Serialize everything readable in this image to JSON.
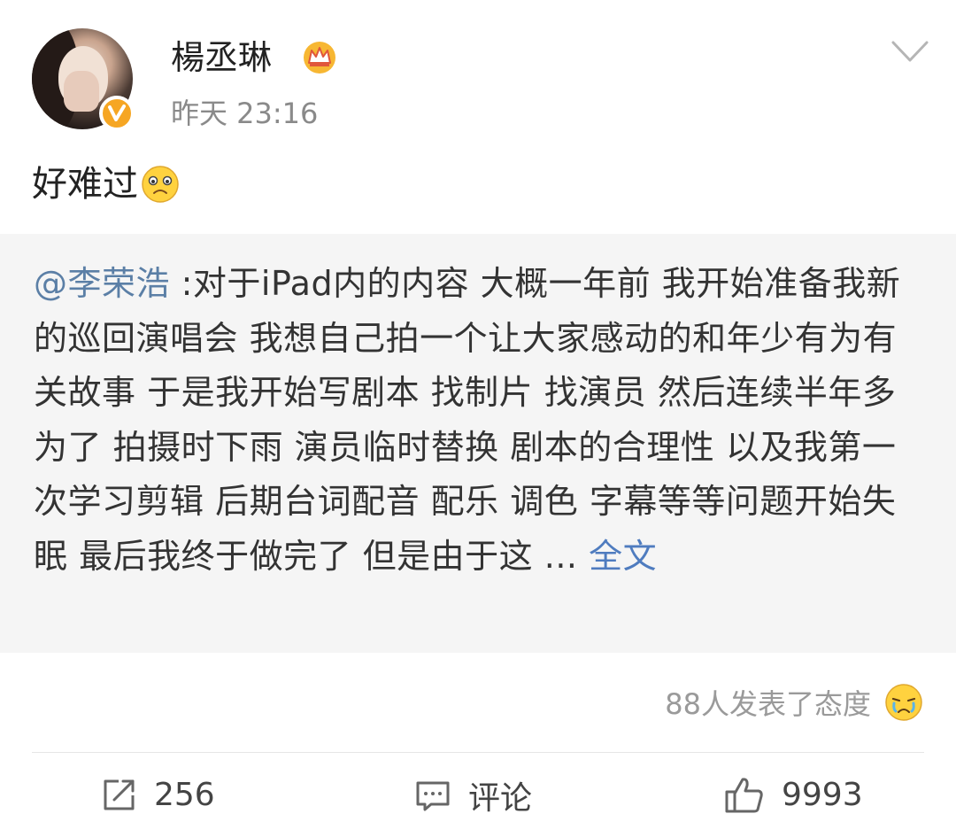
{
  "post": {
    "author": {
      "name": "楊丞琳"
    },
    "time": "昨天 23:16",
    "text": "好难过"
  },
  "repost": {
    "mention": "@李荣浩",
    "text": " :对于iPad内的内容 大概一年前 我开始准备我新的巡回演唱会 我想自己拍一个让大家感动的和年少有为有关故事 于是我开始写剧本 找制片 找演员 然后连续半年多为了 拍摄时下雨 演员临时替换 剧本的合理性 以及我第一次学习剪辑 后期台词配音 配乐 调色 字幕等等问题开始失眠 最后我终于做完了 但是由于这 ... ",
    "full_text_label": "全文"
  },
  "reactions": {
    "label": "88人发表了态度"
  },
  "actions": {
    "repost_count": "256",
    "comment_label": "评论",
    "like_count": "9993"
  },
  "colors": {
    "link": "#5b7fa6",
    "repost_bg": "#f5f5f5",
    "verified": "#f6a623",
    "secondary_text": "#8a8a8a"
  },
  "icons": {
    "verified": "verified-v-badge-icon",
    "crown": "crown-icon",
    "menu": "chevron-down-icon",
    "emoji_sad": "sad-face-emoji-icon",
    "emoji_reaction": "crying-face-emoji-icon",
    "repost": "share-icon",
    "comment": "comment-icon",
    "like": "thumbs-up-icon"
  }
}
